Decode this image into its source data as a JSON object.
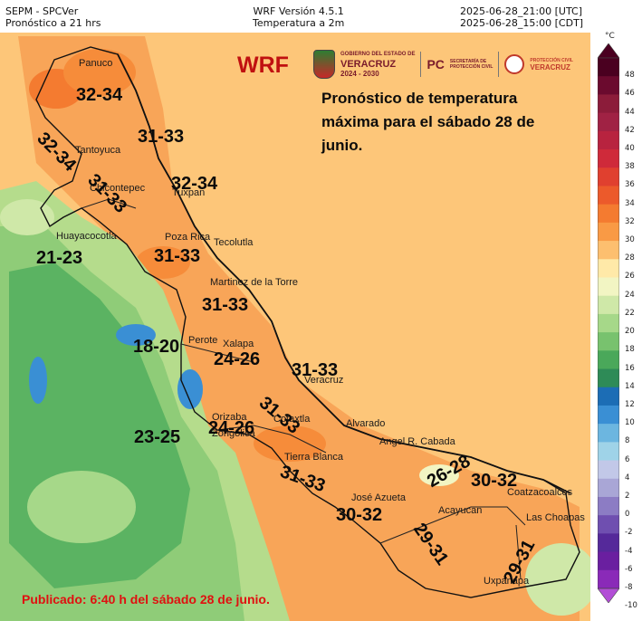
{
  "header": {
    "left_line1": "SEPM - SPCVer",
    "left_line2": "Pronóstico a 21 hrs",
    "center_line1": "WRF Versión 4.5.1",
    "center_line2": "Temperatura a 2m",
    "right_line1": "2025-06-28_21:00 [UTC]",
    "right_line2": "2025-06-28_15:00 [CDT]"
  },
  "map": {
    "model_label": "WRF",
    "description": "Pronóstico de temperatura máxima para el sábado 28 de junio.",
    "published": "Publicado: 6:40 h del sábado 28 de junio.",
    "logos": {
      "gov_line1": "GOBIERNO DEL ESTADO DE",
      "gov_line2": "VERACRUZ",
      "gov_line3": "2024 - 2030",
      "pc_short": "PC",
      "pc_line1": "SECRETARÍA DE",
      "pc_line2": "PROTECCIÓN CIVIL",
      "pc2_line1": "PROTECCIÓN CIVIL",
      "pc2_line2": "VERACRUZ"
    },
    "places": [
      "Panuco",
      "Tantoyuca",
      "Chicontepec",
      "Tuxpan",
      "Huayacocotla",
      "Poza Rica",
      "Tecolutla",
      "Martinez de la Torre",
      "Xalapa",
      "Perote",
      "Veracruz",
      "Alvarado",
      "Orizaba",
      "Zongolica",
      "Cotaxtla",
      "Tierra Blanca",
      "Angel R. Cabada",
      "José Azueta",
      "Acayucan",
      "Coatzacoalcos",
      "Las Choapas",
      "Uxpanapa"
    ],
    "temperature_labels": [
      "32-34",
      "32-34",
      "31-33",
      "31-33",
      "32-34",
      "21-23",
      "31-33",
      "31-33",
      "18-20",
      "24-26",
      "31-33",
      "23-25",
      "24-26",
      "31-33",
      "31-33",
      "26-28",
      "30-32",
      "30-32",
      "29-31",
      "29-31"
    ]
  },
  "colorbar": {
    "unit": "°C",
    "ticks": [
      "48",
      "46",
      "44",
      "42",
      "40",
      "38",
      "36",
      "34",
      "32",
      "30",
      "28",
      "26",
      "24",
      "22",
      "20",
      "18",
      "16",
      "14",
      "12",
      "10",
      "8",
      "6",
      "4",
      "2",
      "0",
      "-2",
      "-4",
      "-6",
      "-8",
      "-10"
    ],
    "colors": [
      "#4a0020",
      "#6b0a2e",
      "#8c1c3a",
      "#a02244",
      "#b8233f",
      "#cf2a3a",
      "#e0402f",
      "#ec5a2b",
      "#f47b30",
      "#f99a45",
      "#fdbf6f",
      "#ffe9a8",
      "#f2f5c3",
      "#cfe8a8",
      "#a6d889",
      "#78c26e",
      "#4aa85a",
      "#2e8b57",
      "#1c6db5",
      "#3a8fd4",
      "#6cb6e0",
      "#9fd3e8",
      "#c2c8e8",
      "#a9a6d6",
      "#8c7cc4",
      "#6f4fb0",
      "#55299a",
      "#6a1fa0",
      "#8a2ab8",
      "#b24ed6"
    ]
  }
}
